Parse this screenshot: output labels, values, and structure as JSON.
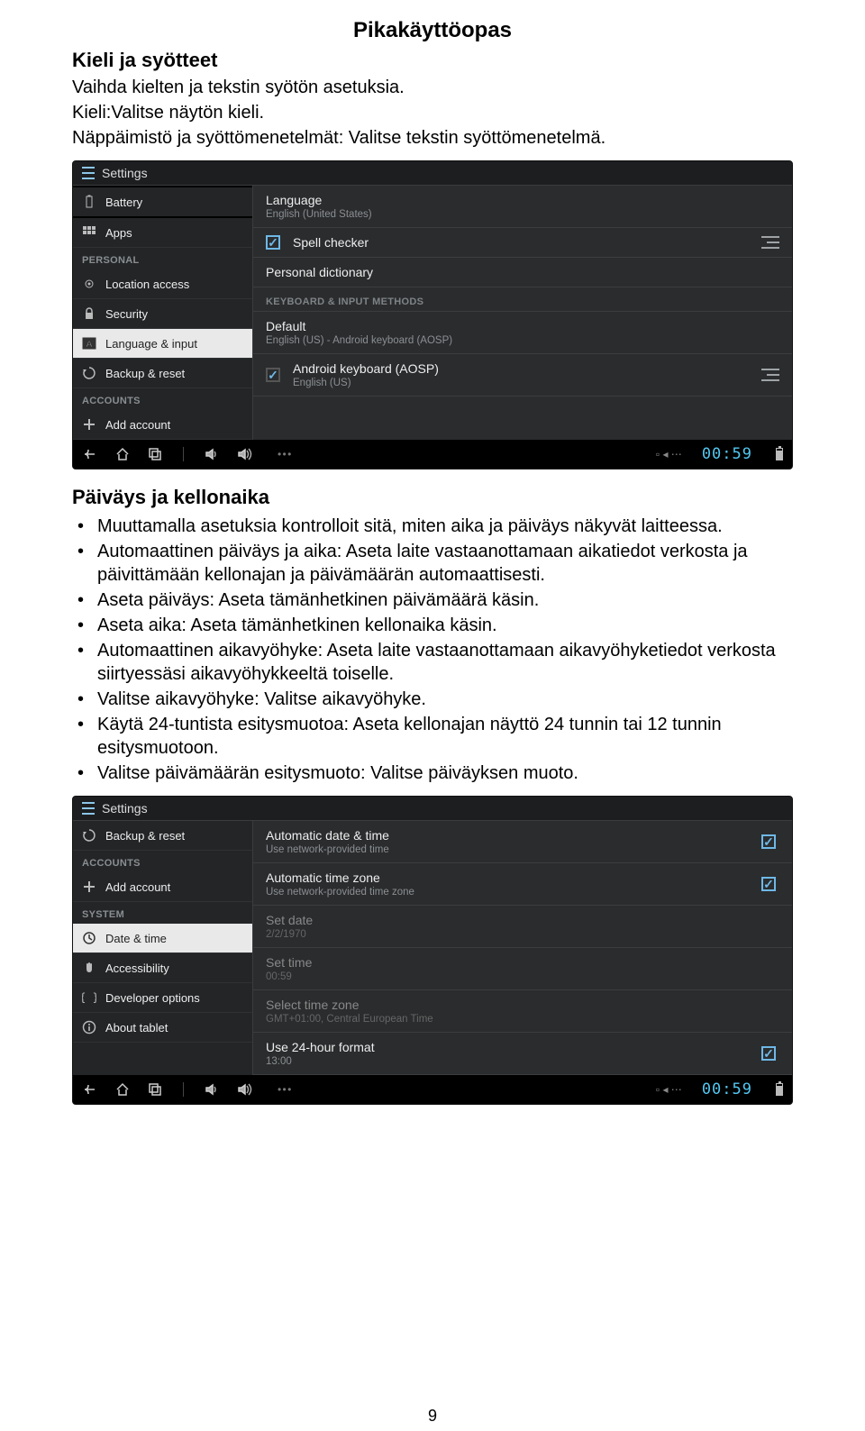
{
  "document": {
    "title": "Pikakäyttöopas",
    "page_number": "9",
    "sections": {
      "lang_input": {
        "heading": "Kieli ja syötteet",
        "line1": "Vaihda kielten ja tekstin syötön asetuksia.",
        "line2": "Kieli:Valitse näytön kieli.",
        "line3": "Näppäimistö ja syöttömenetelmät: Valitse tekstin syöttömenetelmä."
      },
      "date_time": {
        "heading": "Päiväys ja kellonaika",
        "bullets": [
          "Muuttamalla asetuksia kontrolloit sitä, miten aika ja päiväys näkyvät laitteessa.",
          "Automaattinen päiväys ja aika: Aseta laite vastaanottamaan aikatiedot verkosta ja päivittämään kellonajan ja päivämäärän automaattisesti.",
          "Aseta päiväys: Aseta tämänhetkinen päivämäärä käsin.",
          "Aseta aika: Aseta tämänhetkinen kellonaika käsin.",
          "Automaattinen aikavyöhyke: Aseta laite vastaanottamaan aikavyöhyketiedot verkosta siirtyessäsi aikavyöhykkeeltä toiselle.",
          "Valitse aikavyöhyke: Valitse aikavyöhyke.",
          "Käytä 24-tuntista esitysmuotoa: Aseta kellonajan näyttö 24 tunnin tai 12 tunnin esitysmuotoon.",
          "Valitse päivämäärän esitysmuoto: Valitse päiväyksen muoto."
        ]
      }
    }
  },
  "screenshot1": {
    "header": "Settings",
    "sidebar": {
      "headers": {
        "personal": "PERSONAL",
        "accounts": "ACCOUNTS"
      },
      "items": {
        "battery": "Battery",
        "apps": "Apps",
        "location": "Location access",
        "security": "Security",
        "lang_input": "Language & input",
        "backup": "Backup & reset",
        "add_account": "Add account"
      }
    },
    "main": {
      "language": {
        "title": "Language",
        "sub": "English (United States)"
      },
      "spell": {
        "title": "Spell checker"
      },
      "dictionary": {
        "title": "Personal dictionary"
      },
      "kb_header": "KEYBOARD & INPUT METHODS",
      "default": {
        "title": "Default",
        "sub": "English (US) - Android keyboard (AOSP)"
      },
      "android_kb": {
        "title": "Android keyboard (AOSP)",
        "sub": "English (US)"
      }
    },
    "navbar": {
      "clock": "00:59"
    }
  },
  "screenshot2": {
    "header": "Settings",
    "sidebar": {
      "headers": {
        "accounts": "ACCOUNTS",
        "system": "SYSTEM"
      },
      "items": {
        "backup": "Backup & reset",
        "add_account": "Add account",
        "date_time": "Date & time",
        "accessibility": "Accessibility",
        "developer": "Developer options",
        "about": "About tablet"
      }
    },
    "main": {
      "auto_dt": {
        "title": "Automatic date & time",
        "sub": "Use network-provided time"
      },
      "auto_tz": {
        "title": "Automatic time zone",
        "sub": "Use network-provided time zone"
      },
      "set_date": {
        "title": "Set date",
        "sub": "2/2/1970"
      },
      "set_time": {
        "title": "Set time",
        "sub": "00:59"
      },
      "select_tz": {
        "title": "Select time zone",
        "sub": "GMT+01:00, Central European Time"
      },
      "use_24h": {
        "title": "Use 24-hour format",
        "sub": "13:00"
      }
    },
    "navbar": {
      "clock": "00:59"
    }
  }
}
